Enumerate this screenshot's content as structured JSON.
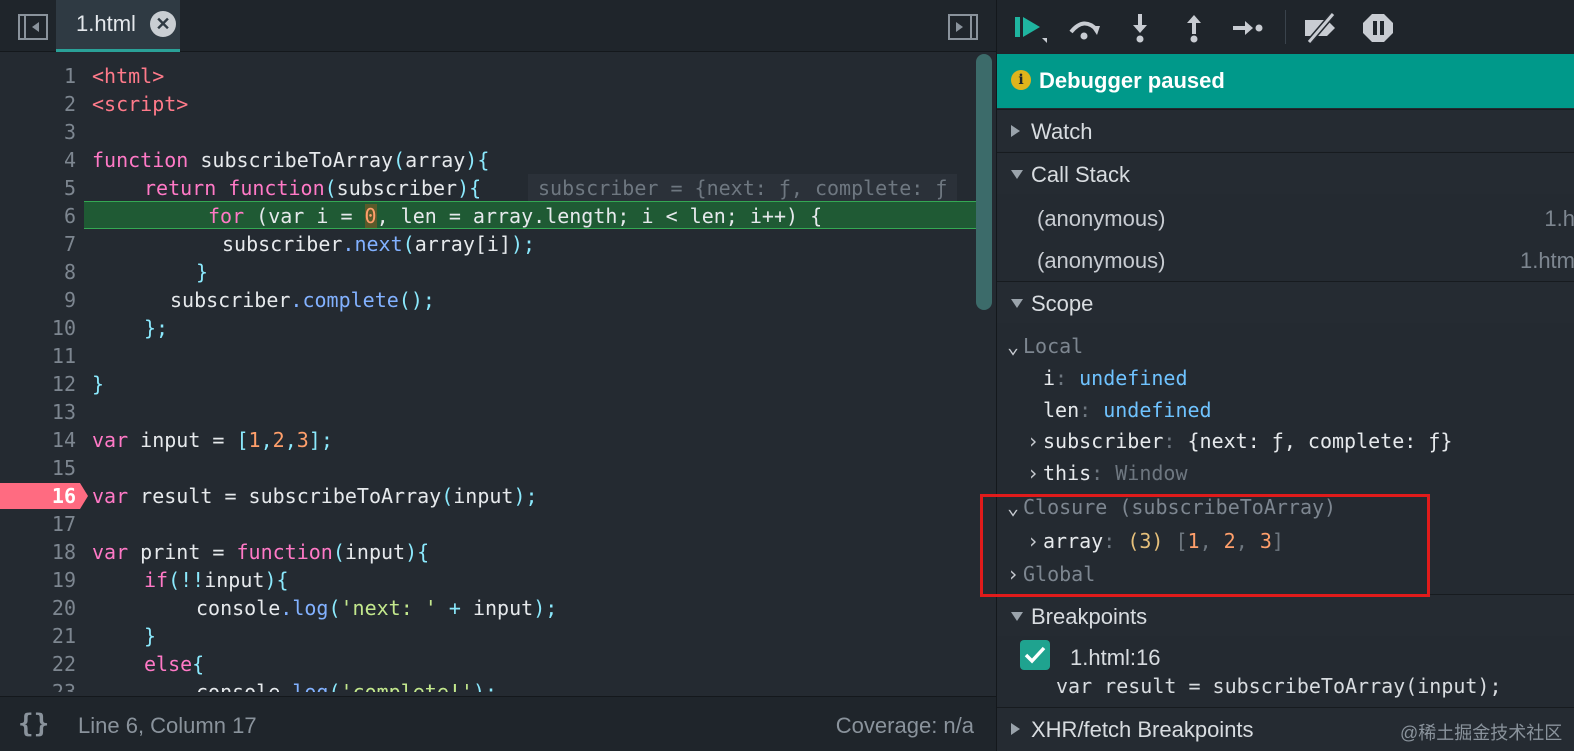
{
  "editor": {
    "tab_label": "1.html",
    "close_glyph": "✕",
    "status_braces": "{}",
    "status_position": "Line 6, Column 17",
    "status_coverage": "Coverage: n/a"
  },
  "code_lines": [
    {
      "n": "1"
    },
    {
      "n": "2"
    },
    {
      "n": "3"
    },
    {
      "n": "4"
    },
    {
      "n": "5"
    },
    {
      "n": "6"
    },
    {
      "n": "7"
    },
    {
      "n": "8"
    },
    {
      "n": "9"
    },
    {
      "n": "10"
    },
    {
      "n": "11"
    },
    {
      "n": "12"
    },
    {
      "n": "13"
    },
    {
      "n": "14"
    },
    {
      "n": "15"
    },
    {
      "n": "16"
    },
    {
      "n": "17"
    },
    {
      "n": "18"
    },
    {
      "n": "19"
    },
    {
      "n": "20"
    },
    {
      "n": "21"
    },
    {
      "n": "22"
    },
    {
      "n": "23"
    }
  ],
  "code_text": {
    "l1": "<html>",
    "l2": "<script>",
    "l4a": "function",
    "l4b": " subscribeToArray",
    "l4c": "(",
    "l4d": "array",
    "l4e": "){",
    "l5a": "return",
    "l5b": "function",
    "l5c": "(",
    "l5d": "subscriber",
    "l5e": "){",
    "l5ghost": "subscriber = {next: ƒ, complete: ƒ",
    "l6": "for (var i = 0, len = array.length; i < len; i++) {",
    "l7a": "subscriber",
    "l7b": ".next",
    "l7c": "(",
    "l7d": "array[i]",
    "l7e": ");",
    "l8": "}",
    "l9a": "subscriber",
    "l9b": ".complete",
    "l9c": "();",
    "l10": "};",
    "l12": "}",
    "l14a": "var",
    "l14b": " input = ",
    "l14c": "[",
    "l14d": "1",
    "l14e": ",",
    "l14f": "2",
    "l14g": ",",
    "l14h": "3",
    "l14i": "];",
    "l16a": "var",
    "l16b": " result = subscribeToArray",
    "l16c": "(",
    "l16d": "input",
    "l16e": ");",
    "l18a": "var",
    "l18b": " print = ",
    "l18c": "function",
    "l18d": "(",
    "l18e": "input",
    "l18f": "){",
    "l19a": "if",
    "l19b": "(!!",
    "l19c": "input",
    "l19d": "){",
    "l20a": "console",
    "l20b": ".log",
    "l20c": "(",
    "l20d": "'next: '",
    "l20e": " + ",
    "l20f": "input",
    "l20g": ");",
    "l21": "}",
    "l22a": "else",
    "l22b": "{",
    "l23a": "console",
    "l23b": ".log",
    "l23c": "(",
    "l23d": "'complete!'",
    "l23e": ");"
  },
  "debugger": {
    "paused_icon": "i",
    "paused_text": "Debugger paused",
    "sections": {
      "watch": "Watch",
      "call_stack": "Call Stack",
      "scope": "Scope",
      "breakpoints": "Breakpoints",
      "xhr": "XHR/fetch Breakpoints"
    },
    "call_stack": [
      {
        "name": "(anonymous)",
        "location": "1.h"
      },
      {
        "name": "(anonymous)",
        "location": "1.htm"
      }
    ],
    "scope": {
      "local_label": "Local",
      "i_key": "i",
      "i_val": "undefined",
      "len_key": "len",
      "len_val": "undefined",
      "subscriber_key": "subscriber",
      "subscriber_val": "{next: ƒ, complete: ƒ}",
      "this_key": "this",
      "this_val": "Window",
      "closure_label": "Closure (subscribeToArray)",
      "array_key": "array",
      "array_len": "(3)",
      "array_open": "[",
      "array_v1": "1",
      "array_v2": "2",
      "array_v3": "3",
      "array_sep": ", ",
      "array_close": "]",
      "global_label": "Global"
    },
    "breakpoint": {
      "checked": true,
      "location": "1.html:16",
      "code": "var result = subscribeToArray(input);"
    }
  },
  "watermark": "@稀土掘金技术社区",
  "colors": {
    "accent": "#00998a",
    "breakpoint": "#ff6b81",
    "exec_line": "#1f5a34",
    "highlight_box": "#e01b1b"
  }
}
